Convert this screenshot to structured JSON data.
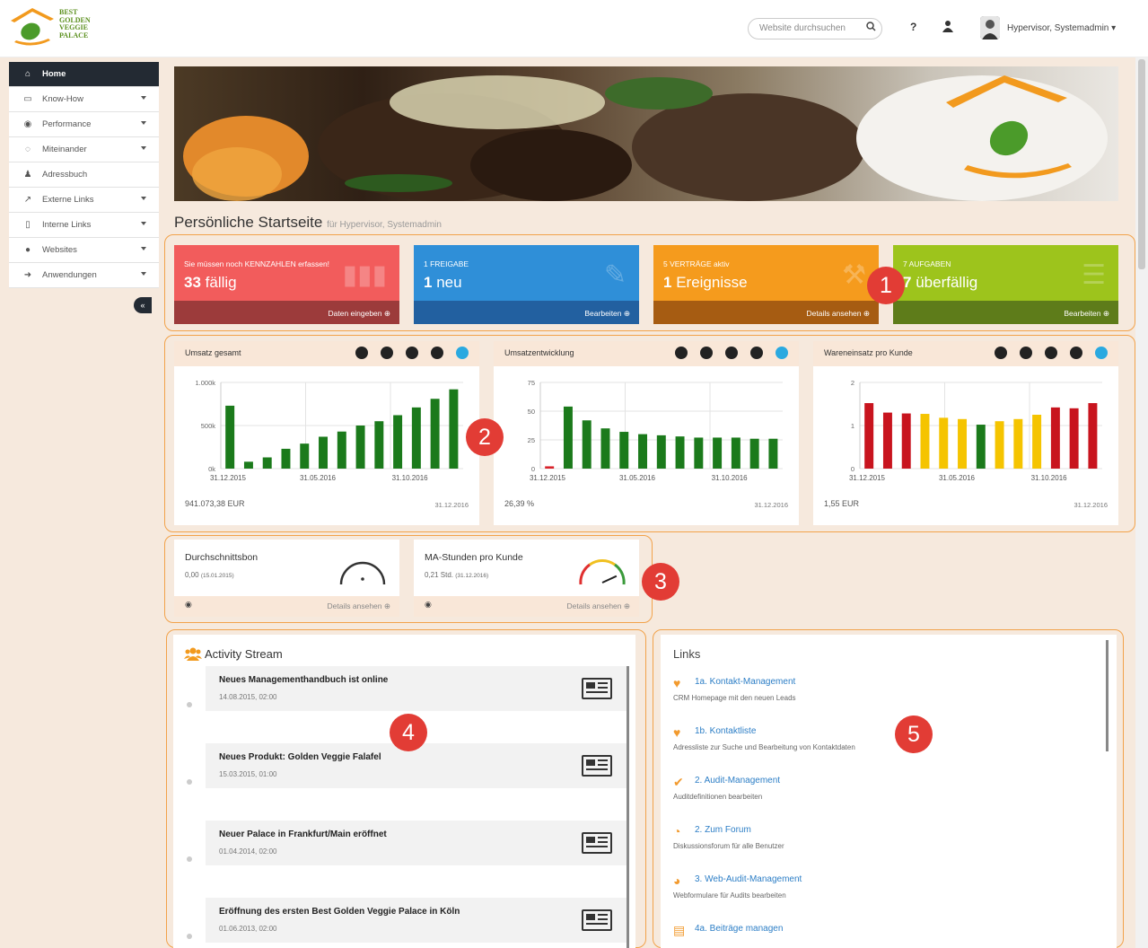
{
  "header": {
    "logo_text": [
      "BEST",
      "GOLDEN",
      "VEGGIE",
      "PALACE"
    ],
    "search_placeholder": "Website durchsuchen",
    "help": "?",
    "user_name": "Hypervisor, Systemadmin"
  },
  "sidebar": {
    "items": [
      {
        "label": "Home",
        "icon": "home-icon",
        "active": true
      },
      {
        "label": "Know-How",
        "icon": "folder-icon",
        "caret": true
      },
      {
        "label": "Performance",
        "icon": "dashboard-icon",
        "caret": true
      },
      {
        "label": "Miteinander",
        "icon": "chat-icon",
        "caret": true
      },
      {
        "label": "Adressbuch",
        "icon": "users-icon"
      },
      {
        "label": "Externe Links",
        "icon": "external-link-icon",
        "caret": true
      },
      {
        "label": "Interne Links",
        "icon": "bookmark-icon",
        "caret": true
      },
      {
        "label": "Websites",
        "icon": "globe-icon",
        "caret": true
      },
      {
        "label": "Anwendungen",
        "icon": "sign-in-icon",
        "caret": true
      }
    ],
    "collapse": "«"
  },
  "page": {
    "title": "Persönliche Startseite",
    "subtitle": "für Hypervisor, Systemadmin"
  },
  "badges": [
    "1",
    "2",
    "3",
    "4",
    "5"
  ],
  "tiles": [
    {
      "label": "Sie müssen noch KENNZAHLEN erfassen!",
      "num": "33",
      "word": "fällig",
      "footer": "Daten eingeben ⊕",
      "color": "#f25c5c",
      "footer_color": "#9c3b3b"
    },
    {
      "label": "1 FREIGABE",
      "num": "1",
      "word": "neu",
      "footer": "Bearbeiten ⊕",
      "color": "#2f8fd8",
      "footer_color": "#2260a0"
    },
    {
      "label": "5 VERTRÄGE aktiv",
      "num": "1",
      "word": "Ereignisse",
      "footer": "Details ansehen ⊕",
      "color": "#f59b1d",
      "footer_color": "#a65c12"
    },
    {
      "label": "7 AUFGABEN",
      "num": "7",
      "word": "überfällig",
      "footer": "Bearbeiten ⊕",
      "color": "#9dc41c",
      "footer_color": "#5e7c1a"
    }
  ],
  "chart_data": [
    {
      "type": "bar",
      "title": "Umsatz gesamt",
      "yticks": [
        "1.000k",
        "500k",
        "0k"
      ],
      "ylim": [
        0,
        1000
      ],
      "xticks": [
        "31.12.2015",
        "31.05.2016",
        "31.10.2016"
      ],
      "values": [
        730,
        80,
        130,
        230,
        290,
        370,
        430,
        500,
        550,
        620,
        710,
        810,
        920
      ],
      "colors": [
        "#1b7a1b",
        "#1b7a1b",
        "#1b7a1b",
        "#1b7a1b",
        "#1b7a1b",
        "#1b7a1b",
        "#1b7a1b",
        "#1b7a1b",
        "#1b7a1b",
        "#1b7a1b",
        "#1b7a1b",
        "#1b7a1b",
        "#1b7a1b"
      ],
      "footer_value": "941.073,38 EUR",
      "footer_date": "31.12.2016"
    },
    {
      "type": "bar",
      "title": "Umsatzentwicklung",
      "yticks": [
        "75",
        "50",
        "25",
        "0"
      ],
      "ylim": [
        0,
        75
      ],
      "xticks": [
        "31.12.2015",
        "31.05.2016",
        "31.10.2016"
      ],
      "values": [
        2,
        54,
        42,
        35,
        32,
        30,
        29,
        28,
        27,
        27,
        27,
        26,
        26
      ],
      "colors": [
        "#d8222a",
        "#1b7a1b",
        "#1b7a1b",
        "#1b7a1b",
        "#1b7a1b",
        "#1b7a1b",
        "#1b7a1b",
        "#1b7a1b",
        "#1b7a1b",
        "#1b7a1b",
        "#1b7a1b",
        "#1b7a1b",
        "#1b7a1b"
      ],
      "footer_value": "26,39 %",
      "footer_date": "31.12.2016"
    },
    {
      "type": "bar",
      "title": "Wareneinsatz pro Kunde",
      "yticks": [
        "2",
        "1",
        "0"
      ],
      "ylim": [
        0,
        2
      ],
      "xticks": [
        "31.12.2015",
        "31.05.2016",
        "31.10.2016"
      ],
      "values": [
        1.52,
        1.3,
        1.28,
        1.27,
        1.18,
        1.15,
        1.02,
        1.1,
        1.15,
        1.25,
        1.42,
        1.4,
        1.52
      ],
      "colors": [
        "#c8141e",
        "#c8141e",
        "#c8141e",
        "#f5c400",
        "#f5c400",
        "#f5c400",
        "#1b7a1b",
        "#f5c400",
        "#f5c400",
        "#f5c400",
        "#c8141e",
        "#c8141e",
        "#c8141e"
      ],
      "footer_value": "1,55 EUR",
      "footer_date": "31.12.2016"
    }
  ],
  "gauges": [
    {
      "title": "Durchschnittsbon",
      "value": "0,00",
      "date": "(15.01.2015)",
      "footer": "Details ansehen ⊕",
      "level": 0.5
    },
    {
      "title": "MA-Stunden pro Kunde",
      "value": "0,21 Std.",
      "date": "(31.12.2016)",
      "footer": "Details ansehen ⊕",
      "level": 0.8
    }
  ],
  "activity": {
    "title": "Activity Stream",
    "items": [
      {
        "title": "Neues Managementhandbuch ist online",
        "date": "14.08.2015, 02:00"
      },
      {
        "title": "Neues Produkt: Golden Veggie Falafel",
        "date": "15.03.2015, 01:00"
      },
      {
        "title": "Neuer Palace in Frankfurt/Main eröffnet",
        "date": "01.04.2014, 02:00"
      },
      {
        "title": "Eröffnung des ersten Best Golden Veggie Palace in Köln",
        "date": "01.06.2013, 02:00"
      }
    ]
  },
  "links": {
    "title": "Links",
    "items": [
      {
        "title": "1a. Kontakt-Management",
        "desc": "CRM Homepage mit den neuen Leads",
        "icon": "heart-icon"
      },
      {
        "title": "1b. Kontaktliste",
        "desc": "Adressliste zur Suche und Bearbeitung von Kontaktdaten",
        "icon": "heart-icon"
      },
      {
        "title": "2. Audit-Management",
        "desc": "Auditdefinitionen bearbeiten",
        "icon": "check-icon"
      },
      {
        "title": "2. Zum Forum",
        "desc": "Diskussionsforum für alle Benutzer",
        "icon": "comments-icon"
      },
      {
        "title": "3. Web-Audit-Management",
        "desc": "Webformulare für Audits bearbeiten",
        "icon": "compass-icon"
      },
      {
        "title": "4a. Beiträge managen",
        "desc": "",
        "icon": "file-icon"
      }
    ]
  }
}
